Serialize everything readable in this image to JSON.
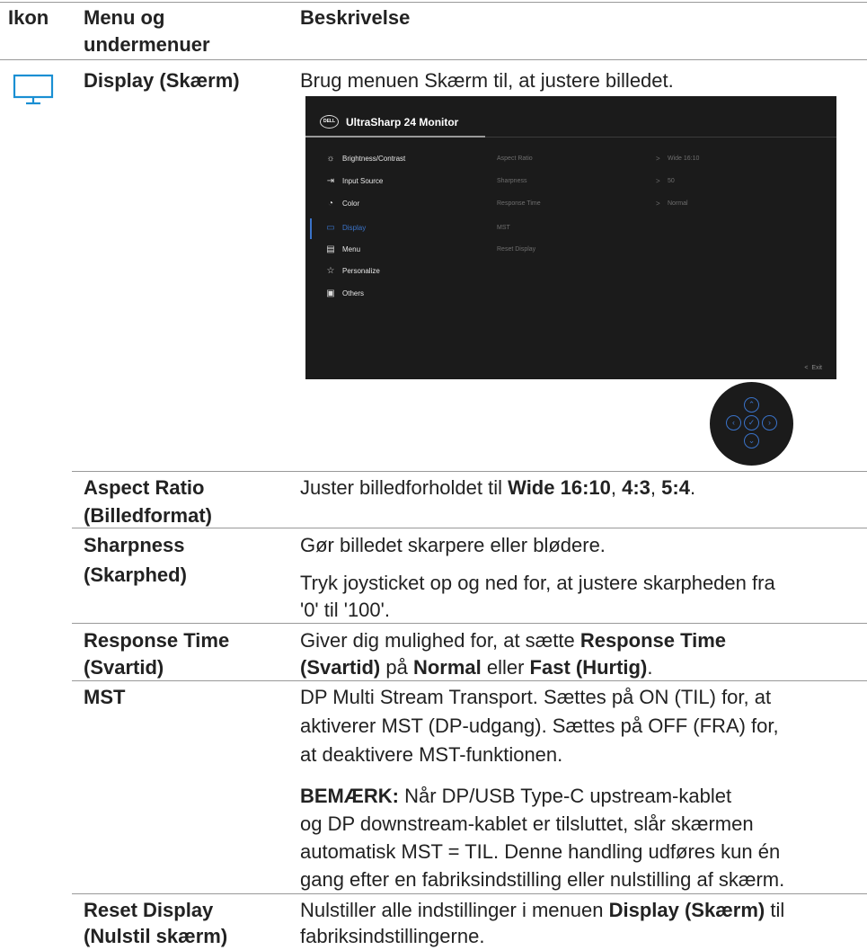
{
  "header": {
    "col_icon": "Ikon",
    "col_menu_line1": "Menu og",
    "col_menu_line2": "undermenuer",
    "col_desc": "Beskrivelse"
  },
  "display_row": {
    "icon": "monitor-icon",
    "menu": "Display (Skærm)",
    "desc": "Brug menuen Skærm til, at justere billedet."
  },
  "osd": {
    "logo": "DELL",
    "title": "UltraSharp 24 Monitor",
    "menu_items": [
      {
        "icon": "brightness-icon",
        "label": "Brightness/Contrast"
      },
      {
        "icon": "input-source-icon",
        "label": "Input Source"
      },
      {
        "icon": "color-icon",
        "label": "Color"
      },
      {
        "icon": "display-icon",
        "label": "Display",
        "selected": true
      },
      {
        "icon": "menu-icon",
        "label": "Menu"
      },
      {
        "icon": "star-icon",
        "label": "Personalize"
      },
      {
        "icon": "others-icon",
        "label": "Others"
      }
    ],
    "submenu": [
      {
        "label": "Aspect Ratio",
        "arrow": ">",
        "value": "Wide 16:10"
      },
      {
        "label": "Sharpness",
        "arrow": ">",
        "value": "50"
      },
      {
        "label": "Response Time",
        "arrow": ">",
        "value": "Normal"
      },
      {
        "label": "MST",
        "arrow": "",
        "value": ""
      },
      {
        "label": "Reset Display",
        "arrow": "",
        "value": ""
      }
    ],
    "exit_label": "Exit",
    "exit_arrow": "<"
  },
  "joystick": {
    "up": "^",
    "down": "v",
    "left": "<",
    "right": ">",
    "center": "✓"
  },
  "aspect": {
    "name1": "Aspect Ratio",
    "name2": "(Billedformat)",
    "desc_pre": "Juster billedforholdet til ",
    "opt1": "Wide 16:10",
    "sep1": ", ",
    "opt2": "4:3",
    "sep2": ", ",
    "opt3": "5:4",
    "desc_end": "."
  },
  "sharpness": {
    "name1": "Sharpness",
    "name2": "(Skarphed)",
    "desc1": "Gør billedet skarpere eller blødere.",
    "desc2_line1": "Tryk joysticket op og ned for, at justere skarpheden fra",
    "desc2_line2": "'0' til '100'."
  },
  "response": {
    "name1": "Response Time",
    "name2": "(Svartid)",
    "l1_pre": "Giver dig mulighed for, at sætte ",
    "l1_bold": "Response Time",
    "l2_bold1": "(Svartid)",
    "l2_mid": " på ",
    "l2_bold2": "Normal",
    "l2_mid2": " eller ",
    "l2_bold3": "Fast (Hurtig)",
    "l2_end": "."
  },
  "mst": {
    "name": "MST",
    "desc_l1": "DP Multi Stream Transport. Sættes på ON (TIL) for, at",
    "desc_l2": "aktiverer MST (DP-udgang). Sættes på OFF (FRA) for,",
    "desc_l3": "at deaktivere MST-funktionen.",
    "note_label": "BEMÆRK:",
    "note_l1": " Når DP/USB Type-C upstream-kablet",
    "note_l2": "og DP downstream-kablet er tilsluttet, slår skærmen",
    "note_l3": "automatisk MST = TIL. Denne handling udføres kun én",
    "note_l4": "gang efter en fabriksindstilling eller nulstilling af skærm."
  },
  "reset": {
    "name1": "Reset Display",
    "name2": "(Nulstil skærm)",
    "l1_pre": "Nulstiller alle indstillinger i menuen ",
    "l1_bold": "Display (Skærm)",
    "l1_end": " til",
    "l2": "fabriksindstillingerne."
  }
}
